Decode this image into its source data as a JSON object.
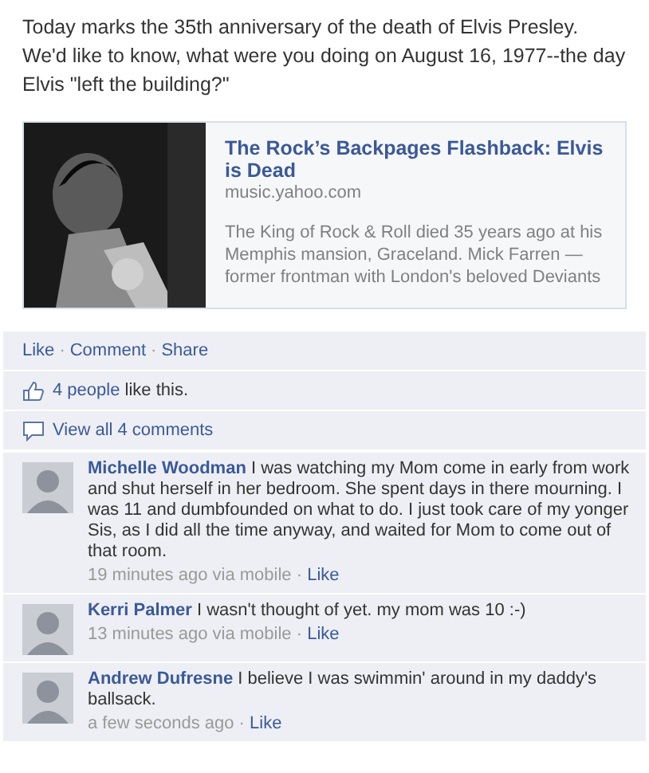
{
  "post": {
    "text": "Today marks the 35th anniversary of the death of Elvis Presley. We'd like to know, what were you doing on August 16, 1977--the day Elvis \"left the building?\""
  },
  "link_card": {
    "title": "The Rock’s Backpages Flashback: Elvis is Dead",
    "domain": "music.yahoo.com",
    "summary": "The King of Rock & Roll died 35 years ago at his Memphis mansion, Graceland. Mick Farren — former frontman with London's beloved Deviants"
  },
  "actions": [
    {
      "label": "Like"
    },
    {
      "sep": "·",
      "label": "Comment"
    },
    {
      "sep": "·",
      "label": "Share"
    }
  ],
  "likes": {
    "link": "4 people",
    "text": "like this."
  },
  "view_all": {
    "label": "View all 4 comments"
  },
  "comments": [
    {
      "author": "Michelle Woodman",
      "text": "I was watching my Mom come in early from work and shut herself in her bedroom. She spent days in there mourning. I was 11 and dumbfounded on what to do. I just took care of my yonger Sis, as I did all the time anyway, and waited for Mom to come out of that room.",
      "time": "19 minutes ago via mobile",
      "sep": "·",
      "like": "Like"
    },
    {
      "author": "Kerri Palmer",
      "text": "I wasn't thought of yet. my mom was 10 :-)",
      "time": "13 minutes ago via mobile",
      "sep": "·",
      "like": "Like"
    },
    {
      "author": "Andrew Dufresne",
      "text": "I believe I was swimmin' around in my daddy's ballsack.",
      "time": "a few seconds ago",
      "sep": "·",
      "like": "Like"
    }
  ]
}
